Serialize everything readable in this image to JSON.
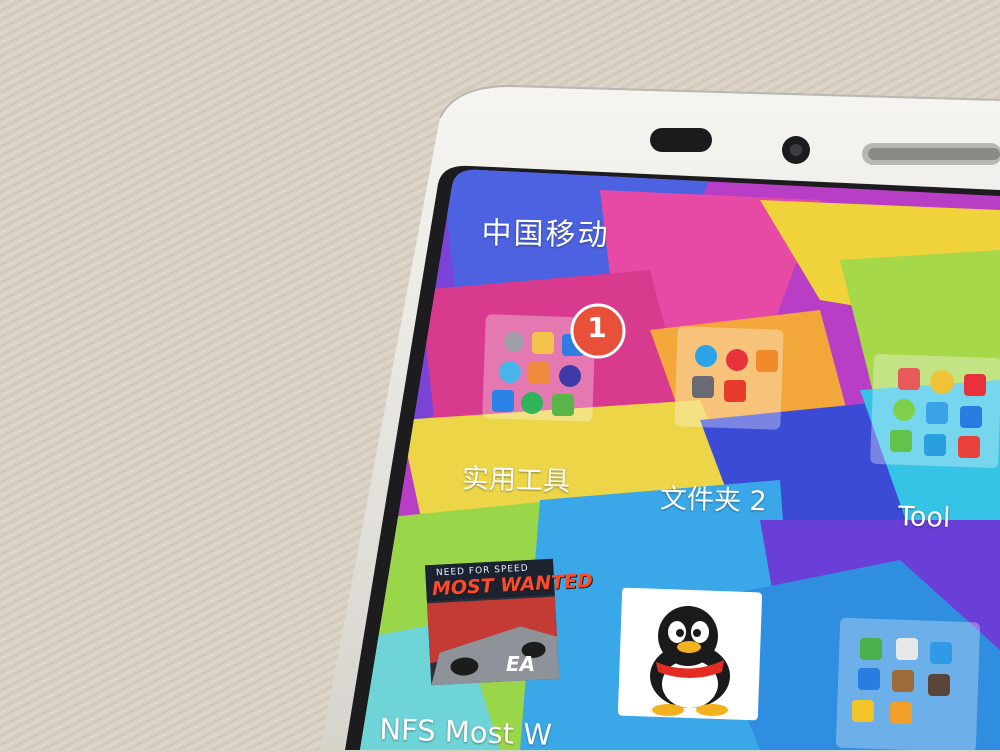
{
  "status_bar": {
    "carrier": "中国移动"
  },
  "folders": [
    {
      "label": "实用工具",
      "badge": "1"
    },
    {
      "label": "文件夹 2"
    },
    {
      "label": "Tool"
    }
  ],
  "apps": [
    {
      "label": "NFS Most W",
      "icon_title": "NEED FOR SPEED",
      "icon_subtitle": "MOST WANTED",
      "icon_brand": "EA"
    },
    {
      "label": "",
      "icon": "qq-penguin-icon"
    }
  ],
  "colors": {
    "badge_red": "#e8503a",
    "desk": "#d9d1c4",
    "phone_frame": "#ecebe6",
    "screen_bezel": "#1c1c1e"
  }
}
